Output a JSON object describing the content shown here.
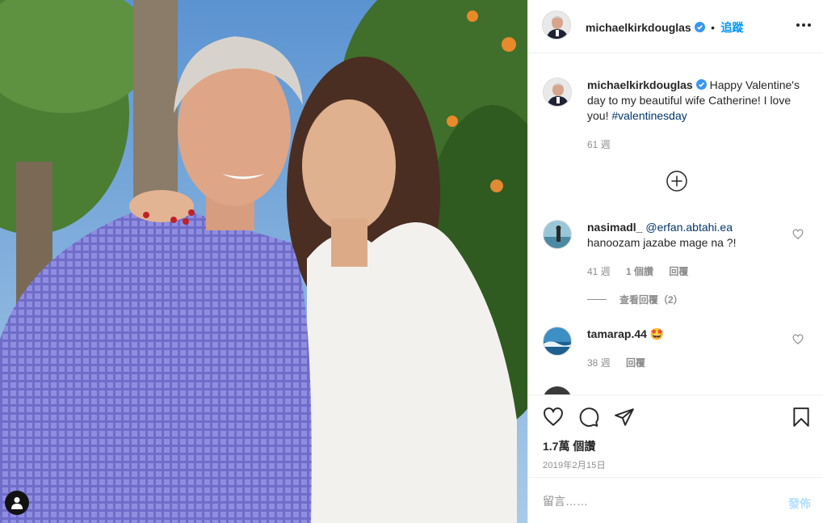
{
  "post": {
    "author": "michaelkirkdouglas",
    "follow_label": "追蹤",
    "separator": "•",
    "caption_lead": "Happy Valentine's day to my beautiful wife Catherine! I love you! ",
    "hashtag": "#valentinesday",
    "caption_age": "61 週",
    "likes": "1.7萬 個讚",
    "date": "2019年2月15日"
  },
  "comments": [
    {
      "user": "nasimadl_",
      "mention": "@erfan.abtahi.ea",
      "text": "hanoozam jazabe mage na ?!",
      "age": "41 週",
      "likes": "1 個讚",
      "reply": "回覆",
      "view_replies": "查看回覆（2）"
    },
    {
      "user": "tamarap.44",
      "emoji": "🤩",
      "age": "38 週",
      "reply": "回覆"
    }
  ],
  "comment_box": {
    "placeholder": "留言……",
    "post_label": "發佈"
  },
  "icons": {
    "verified": "verified-badge-icon",
    "more": "more-options-icon",
    "load_more": "plus-circle-icon",
    "like": "heart-icon",
    "comment": "comment-icon",
    "share": "share-icon",
    "save": "bookmark-icon",
    "user_tag": "user-tag-icon"
  },
  "colors": {
    "accent": "#0095f6",
    "hashtag": "#00376b",
    "muted": "#8e8e8e",
    "verified": "#3897f0",
    "post_disabled": "#b2dffc"
  }
}
